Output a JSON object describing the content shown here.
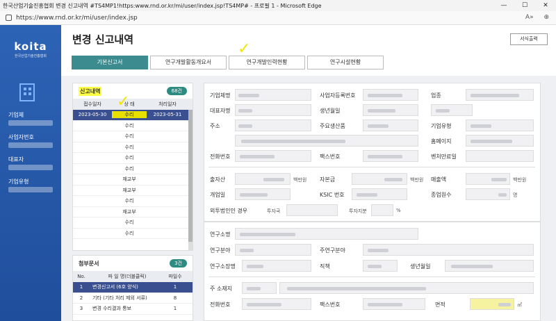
{
  "window": {
    "title": "한국산업기술진흥협회 변경 신고내역 #TS4MP1!https:www.rnd.or.kr/mi/user/index.jsp!TS4MP# - 프로필 1 - Microsoft Edge",
    "url": "https://www.rnd.or.kr/mi/user/index.jsp"
  },
  "sidebar": {
    "logo": "koita",
    "logo_sub": "한국산업기술진흥협회",
    "labels": [
      "기업체",
      "사업자번호",
      "대표자",
      "기업유형"
    ]
  },
  "page": {
    "title": "변경 신고내역",
    "print_label": "서식출력",
    "tabs": [
      "기본신고서",
      "연구개발활동개요서",
      "연구개발인력현황",
      "연구시설현황"
    ]
  },
  "history": {
    "title": "신고내역",
    "count": "68건",
    "headers": [
      "접수일자",
      "상 태",
      "처리일자"
    ],
    "rows": [
      {
        "date": "2023-05-30",
        "status": "수리",
        "done": "2023-05-31"
      },
      {
        "date": "",
        "status": "수리",
        "done": ""
      },
      {
        "date": "",
        "status": "수리",
        "done": ""
      },
      {
        "date": "",
        "status": "수리",
        "done": ""
      },
      {
        "date": "",
        "status": "수리",
        "done": ""
      },
      {
        "date": "",
        "status": "수리",
        "done": ""
      },
      {
        "date": "",
        "status": "재교부",
        "done": ""
      },
      {
        "date": "",
        "status": "재교부",
        "done": ""
      },
      {
        "date": "",
        "status": "수리",
        "done": ""
      },
      {
        "date": "",
        "status": "재교부",
        "done": ""
      },
      {
        "date": "",
        "status": "수리",
        "done": ""
      },
      {
        "date": "",
        "status": "수리",
        "done": ""
      }
    ]
  },
  "attach": {
    "title": "첨부문서",
    "count": "3건",
    "headers": [
      "No.",
      "파 일 명(더블클릭)",
      "파일수"
    ],
    "rows": [
      {
        "no": "1",
        "name": "변경신고서 (6호 양식)",
        "files": "1"
      },
      {
        "no": "2",
        "name": "기타 (기타 처리 제외 서류)",
        "files": "8"
      },
      {
        "no": "3",
        "name": "변경 수리결과 통보",
        "files": "1"
      }
    ]
  },
  "form": {
    "company_name": "기업체명",
    "biz_no": "사업자등록번호",
    "industry": "업종",
    "ceo": "대표자명",
    "birth": "생년월일",
    "address": "주소",
    "product": "주요생산품",
    "company_type": "기업유형",
    "homepage": "홈페이지",
    "phone": "전화번호",
    "fax": "팩스번호",
    "venture_date": "벤처만료일",
    "capital": "출자산",
    "equity": "자본금",
    "sales": "매출액",
    "open_date": "개업일",
    "ksic": "KSIC 번호",
    "employees": "종업원수",
    "foreign": "외투법인인 경우",
    "investor_country": "투자국",
    "invest_ratio": "투자지분",
    "unit_krw": "백만원",
    "unit_person": "명",
    "unit_pct": "%"
  },
  "lab": {
    "name": "연구소명",
    "field": "연구분야",
    "main_field": "주연구분야",
    "head": "연구소장명",
    "position": "직책",
    "birth": "생년월일",
    "address": "주 소재지",
    "phone": "전화번호",
    "fax": "팩스번호",
    "area": "면적",
    "area_unit": "㎡"
  }
}
